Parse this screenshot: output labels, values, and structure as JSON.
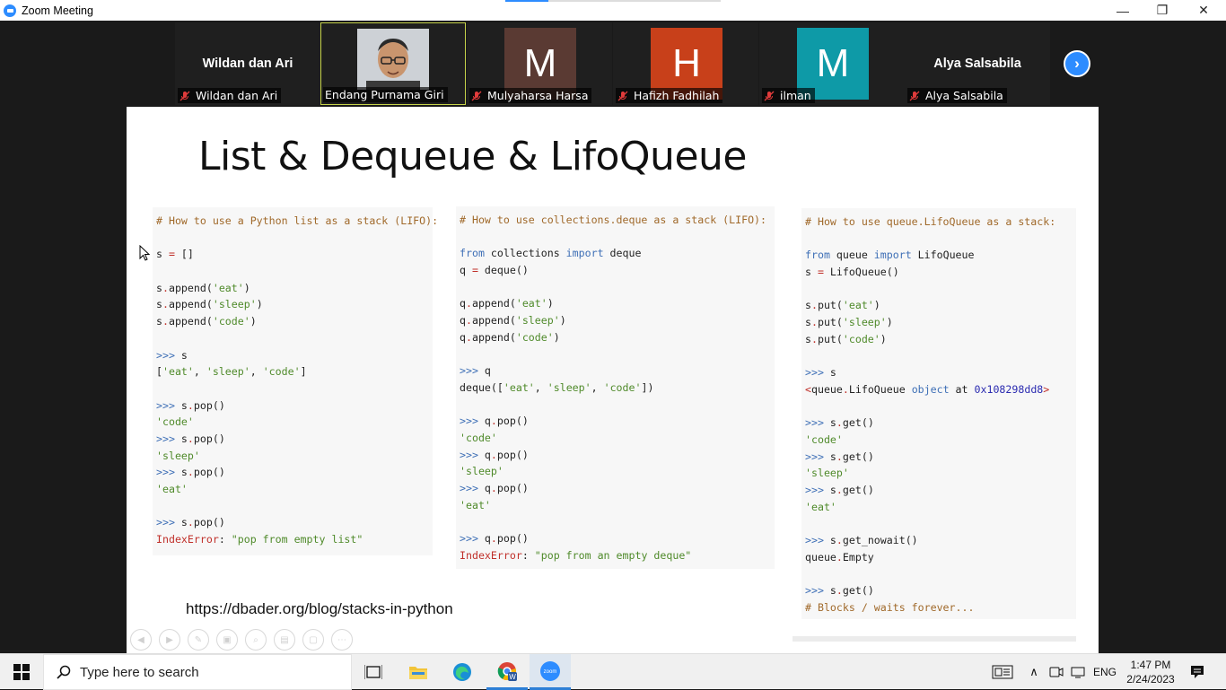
{
  "window": {
    "title": "Zoom Meeting",
    "minimize": "—",
    "restore": "❐",
    "close": "✕"
  },
  "participants": [
    {
      "big_name": "Wildan dan Ari",
      "label": "Wildan dan Ari",
      "muted": true
    },
    {
      "big_name": "",
      "label": "Endang Purnama Giri",
      "muted": false,
      "video": true
    },
    {
      "initial": "M",
      "label": "Mulyaharsa Harsa",
      "muted": true,
      "color": "#5a3a33"
    },
    {
      "initial": "H",
      "label": "Hafizh Fadhilah",
      "muted": true,
      "color": "#c8401a"
    },
    {
      "initial": "M",
      "label": "ilman",
      "muted": true,
      "color": "#0e9aa7"
    },
    {
      "big_name": "Alya Salsabila",
      "label": "Alya Salsabila",
      "muted": true
    }
  ],
  "next_button": "›",
  "slide": {
    "title": "List & Dequeue & LifoQueue",
    "url": "https://dbader.org/blog/stacks-in-python",
    "code_list": [
      [
        [
          "cmt",
          "# How to use a Python list as a stack (LIFO):"
        ]
      ],
      [],
      [
        [
          "",
          "s "
        ],
        [
          "err",
          "="
        ],
        [
          "",
          " []"
        ]
      ],
      [],
      [
        [
          "",
          "s"
        ],
        [
          "err",
          "."
        ],
        [
          "",
          "append("
        ],
        [
          "str",
          "'eat'"
        ],
        [
          "",
          ")"
        ]
      ],
      [
        [
          "",
          "s"
        ],
        [
          "err",
          "."
        ],
        [
          "",
          "append("
        ],
        [
          "str",
          "'sleep'"
        ],
        [
          "",
          ")"
        ]
      ],
      [
        [
          "",
          "s"
        ],
        [
          "err",
          "."
        ],
        [
          "",
          "append("
        ],
        [
          "str",
          "'code'"
        ],
        [
          "",
          ")"
        ]
      ],
      [],
      [
        [
          "kw",
          ">>>"
        ],
        [
          "",
          " s"
        ]
      ],
      [
        [
          "",
          "["
        ],
        [
          "str",
          "'eat'"
        ],
        [
          "",
          ", "
        ],
        [
          "str",
          "'sleep'"
        ],
        [
          "",
          ", "
        ],
        [
          "str",
          "'code'"
        ],
        [
          "",
          "]"
        ]
      ],
      [],
      [
        [
          "kw",
          ">>>"
        ],
        [
          "",
          " s"
        ],
        [
          "err",
          "."
        ],
        [
          "",
          "pop()"
        ]
      ],
      [
        [
          "str",
          "'code'"
        ]
      ],
      [
        [
          "kw",
          ">>>"
        ],
        [
          "",
          " s"
        ],
        [
          "err",
          "."
        ],
        [
          "",
          "pop()"
        ]
      ],
      [
        [
          "str",
          "'sleep'"
        ]
      ],
      [
        [
          "kw",
          ">>>"
        ],
        [
          "",
          " s"
        ],
        [
          "err",
          "."
        ],
        [
          "",
          "pop()"
        ]
      ],
      [
        [
          "str",
          "'eat'"
        ]
      ],
      [],
      [
        [
          "kw",
          ">>>"
        ],
        [
          "",
          " s"
        ],
        [
          "err",
          "."
        ],
        [
          "",
          "pop()"
        ]
      ],
      [
        [
          "err",
          "IndexError"
        ],
        [
          "",
          ": "
        ],
        [
          "str",
          "\"pop from empty list\""
        ]
      ]
    ],
    "code_deque": [
      [
        [
          "cmt",
          "# How to use collections.deque as a stack (LIFO):"
        ]
      ],
      [],
      [
        [
          "kw",
          "from"
        ],
        [
          "",
          " collections "
        ],
        [
          "kw",
          "import"
        ],
        [
          "",
          " deque"
        ]
      ],
      [
        [
          "",
          "q "
        ],
        [
          "err",
          "="
        ],
        [
          "",
          " deque()"
        ]
      ],
      [],
      [
        [
          "",
          "q"
        ],
        [
          "err",
          "."
        ],
        [
          "",
          "append("
        ],
        [
          "str",
          "'eat'"
        ],
        [
          "",
          ")"
        ]
      ],
      [
        [
          "",
          "q"
        ],
        [
          "err",
          "."
        ],
        [
          "",
          "append("
        ],
        [
          "str",
          "'sleep'"
        ],
        [
          "",
          ")"
        ]
      ],
      [
        [
          "",
          "q"
        ],
        [
          "err",
          "."
        ],
        [
          "",
          "append("
        ],
        [
          "str",
          "'code'"
        ],
        [
          "",
          ")"
        ]
      ],
      [],
      [
        [
          "kw",
          ">>>"
        ],
        [
          "",
          " q"
        ]
      ],
      [
        [
          "",
          "deque(["
        ],
        [
          "str",
          "'eat'"
        ],
        [
          "",
          ", "
        ],
        [
          "str",
          "'sleep'"
        ],
        [
          "",
          ", "
        ],
        [
          "str",
          "'code'"
        ],
        [
          "",
          "])"
        ]
      ],
      [],
      [
        [
          "kw",
          ">>>"
        ],
        [
          "",
          " q"
        ],
        [
          "err",
          "."
        ],
        [
          "",
          "pop()"
        ]
      ],
      [
        [
          "str",
          "'code'"
        ]
      ],
      [
        [
          "kw",
          ">>>"
        ],
        [
          "",
          " q"
        ],
        [
          "err",
          "."
        ],
        [
          "",
          "pop()"
        ]
      ],
      [
        [
          "str",
          "'sleep'"
        ]
      ],
      [
        [
          "kw",
          ">>>"
        ],
        [
          "",
          " q"
        ],
        [
          "err",
          "."
        ],
        [
          "",
          "pop()"
        ]
      ],
      [
        [
          "str",
          "'eat'"
        ]
      ],
      [],
      [
        [
          "kw",
          ">>>"
        ],
        [
          "",
          " q"
        ],
        [
          "err",
          "."
        ],
        [
          "",
          "pop()"
        ]
      ],
      [
        [
          "err",
          "IndexError"
        ],
        [
          "",
          ": "
        ],
        [
          "str",
          "\"pop from an empty deque\""
        ]
      ]
    ],
    "code_lifo": [
      [
        [
          "cmt",
          "# How to use queue.LifoQueue as a stack:"
        ]
      ],
      [],
      [
        [
          "kw",
          "from"
        ],
        [
          "",
          " queue "
        ],
        [
          "kw",
          "import"
        ],
        [
          "",
          " LifoQueue"
        ]
      ],
      [
        [
          "",
          "s "
        ],
        [
          "err",
          "="
        ],
        [
          "",
          " LifoQueue()"
        ]
      ],
      [],
      [
        [
          "",
          "s"
        ],
        [
          "err",
          "."
        ],
        [
          "",
          "put("
        ],
        [
          "str",
          "'eat'"
        ],
        [
          "",
          ")"
        ]
      ],
      [
        [
          "",
          "s"
        ],
        [
          "err",
          "."
        ],
        [
          "",
          "put("
        ],
        [
          "str",
          "'sleep'"
        ],
        [
          "",
          ")"
        ]
      ],
      [
        [
          "",
          "s"
        ],
        [
          "err",
          "."
        ],
        [
          "",
          "put("
        ],
        [
          "str",
          "'code'"
        ],
        [
          "",
          ")"
        ]
      ],
      [],
      [
        [
          "kw",
          ">>>"
        ],
        [
          "",
          " s"
        ]
      ],
      [
        [
          "err",
          "<"
        ],
        [
          "",
          "queue"
        ],
        [
          "err",
          "."
        ],
        [
          "",
          "LifoQueue "
        ],
        [
          "kw",
          "object"
        ],
        [
          "",
          " at "
        ],
        [
          "num",
          "0x108298dd8"
        ],
        [
          "err",
          ">"
        ]
      ],
      [],
      [
        [
          "kw",
          ">>>"
        ],
        [
          "",
          " s"
        ],
        [
          "err",
          "."
        ],
        [
          "",
          "get()"
        ]
      ],
      [
        [
          "str",
          "'code'"
        ]
      ],
      [
        [
          "kw",
          ">>>"
        ],
        [
          "",
          " s"
        ],
        [
          "err",
          "."
        ],
        [
          "",
          "get()"
        ]
      ],
      [
        [
          "str",
          "'sleep'"
        ]
      ],
      [
        [
          "kw",
          ">>>"
        ],
        [
          "",
          " s"
        ],
        [
          "err",
          "."
        ],
        [
          "",
          "get()"
        ]
      ],
      [
        [
          "str",
          "'eat'"
        ]
      ],
      [],
      [
        [
          "kw",
          ">>>"
        ],
        [
          "",
          " s"
        ],
        [
          "err",
          "."
        ],
        [
          "",
          "get_nowait()"
        ]
      ],
      [
        [
          "",
          "queue"
        ],
        [
          "err",
          "."
        ],
        [
          "",
          "Empty"
        ]
      ],
      [],
      [
        [
          "kw",
          ">>>"
        ],
        [
          "",
          " s"
        ],
        [
          "err",
          "."
        ],
        [
          "",
          "get()"
        ]
      ],
      [
        [
          "cmt",
          "# Blocks / waits forever..."
        ]
      ]
    ]
  },
  "taskbar": {
    "search_placeholder": "Type here to search",
    "language": "ENG",
    "time": "1:47 PM",
    "date": "2/24/2023"
  }
}
